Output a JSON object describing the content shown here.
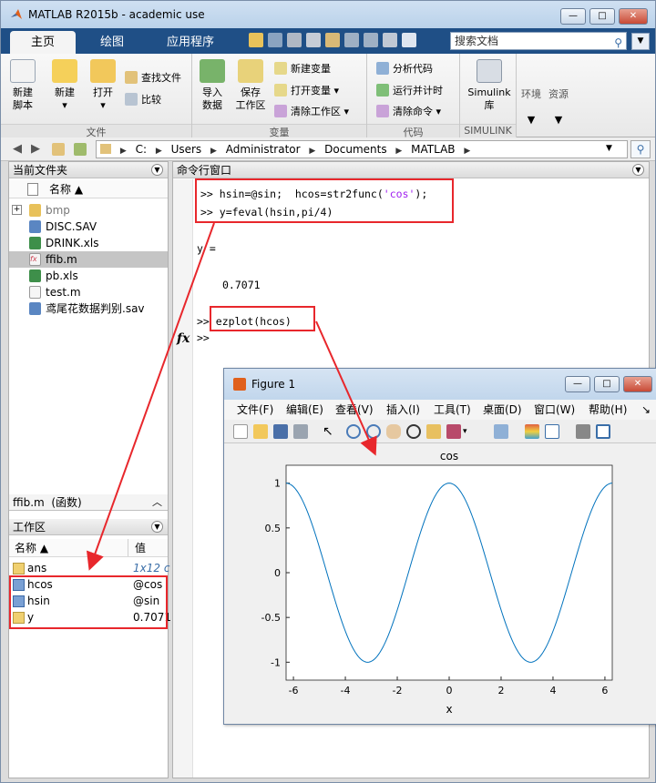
{
  "window": {
    "title": "MATLAB R2015b - academic use",
    "min_glyph": "—",
    "max_glyph": "□",
    "close_glyph": "✕"
  },
  "ribbon_tabs": [
    "主页",
    "绘图",
    "应用程序"
  ],
  "search": {
    "placeholder": "搜索文档",
    "icon": "search-icon"
  },
  "ribbon": {
    "file_group": {
      "label": "文件",
      "new_script": "新建\n脚本",
      "new": "新建",
      "open": "打开",
      "find_files": "查找文件",
      "compare": "比较"
    },
    "variable_group": {
      "label": "变量",
      "import_data": "导入\n数据",
      "save_workspace": "保存\n工作区",
      "new_variable": "新建变量",
      "open_variable": "打开变量",
      "clear_workspace": "清除工作区"
    },
    "code_group": {
      "label": "代码",
      "analyze_code": "分析代码",
      "run_and_time": "运行并计时",
      "clear_commands": "清除命令"
    },
    "simulink_group": {
      "label": "SIMULINK",
      "simulink_library": "Simulink\n库"
    },
    "environment": "环境",
    "resources": "资源"
  },
  "address": {
    "segments": [
      "C:",
      "Users",
      "Administrator",
      "Documents",
      "MATLAB"
    ],
    "separator": "▶"
  },
  "current_folder": {
    "title": "当前文件夹",
    "column_name": "名称 ▲",
    "files": [
      {
        "name": "bmp",
        "type": "folder"
      },
      {
        "name": "DISC.SAV",
        "type": "mat"
      },
      {
        "name": "DRINK.xls",
        "type": "excel"
      },
      {
        "name": "ffib.m",
        "type": "function"
      },
      {
        "name": "pb.xls",
        "type": "excel"
      },
      {
        "name": "test.m",
        "type": "script"
      },
      {
        "name": "鸢尾花数据判别.sav",
        "type": "mat"
      }
    ],
    "details": "ffib.m  (函数)"
  },
  "workspace": {
    "title": "工作区",
    "column_name": "名称 ▲",
    "column_value": "值",
    "vars": [
      {
        "name": "ans",
        "value": "1x12 c"
      },
      {
        "name": "hcos",
        "value": "@cos"
      },
      {
        "name": "hsin",
        "value": "@sin"
      },
      {
        "name": "y",
        "value": "0.7071"
      }
    ]
  },
  "command_window": {
    "title": "命令行窗口",
    "line1_prefix": ">> hsin=@sin;  hcos=str2func(",
    "line1_str": "'cos'",
    "line1_suffix": ");",
    "line2": ">> y=feval(hsin,pi/4)",
    "output_label": "y =",
    "output_value": "0.7071",
    "line3": ">> ezplot(hcos)",
    "prompt": ">>",
    "fx_glyph": "fx"
  },
  "figure": {
    "title": "Figure 1",
    "menu": [
      "文件(F)",
      "编辑(E)",
      "查看(V)",
      "插入(I)",
      "工具(T)",
      "桌面(D)",
      "窗口(W)",
      "帮助(H)"
    ],
    "menu_more": "↘"
  },
  "chart_data": {
    "type": "line",
    "title": "cos",
    "xlabel": "x",
    "ylabel": "",
    "function": "cos(x)",
    "xlim": [
      -6.2832,
      6.2832
    ],
    "ylim": [
      -1.2,
      1.2
    ],
    "xticks": [
      -6,
      -4,
      -2,
      0,
      2,
      4,
      6
    ],
    "yticks": [
      1,
      0.5,
      0,
      -0.5,
      -1
    ],
    "ytick_labels": [
      "1",
      "0.5",
      "0",
      "-0.5",
      "-1"
    ],
    "series": [
      {
        "color": "#0072bd",
        "x": [
          -6.2832,
          -5.4978,
          -4.7124,
          -3.927,
          -3.1416,
          -2.3562,
          -1.5708,
          -0.7854,
          0,
          0.7854,
          1.5708,
          2.3562,
          3.1416,
          3.927,
          4.7124,
          5.4978,
          6.2832
        ],
        "values": [
          1,
          0.7071,
          0,
          -0.7071,
          -1,
          -0.7071,
          0,
          0.7071,
          1,
          0.7071,
          0,
          -0.7071,
          -1,
          -0.7071,
          0,
          0.7071,
          1
        ]
      }
    ],
    "grid": false
  },
  "colors": {
    "highlight_box": "#e8272c",
    "ribbon_tab_bar": "#1f4f86",
    "line": "#0072bd"
  }
}
